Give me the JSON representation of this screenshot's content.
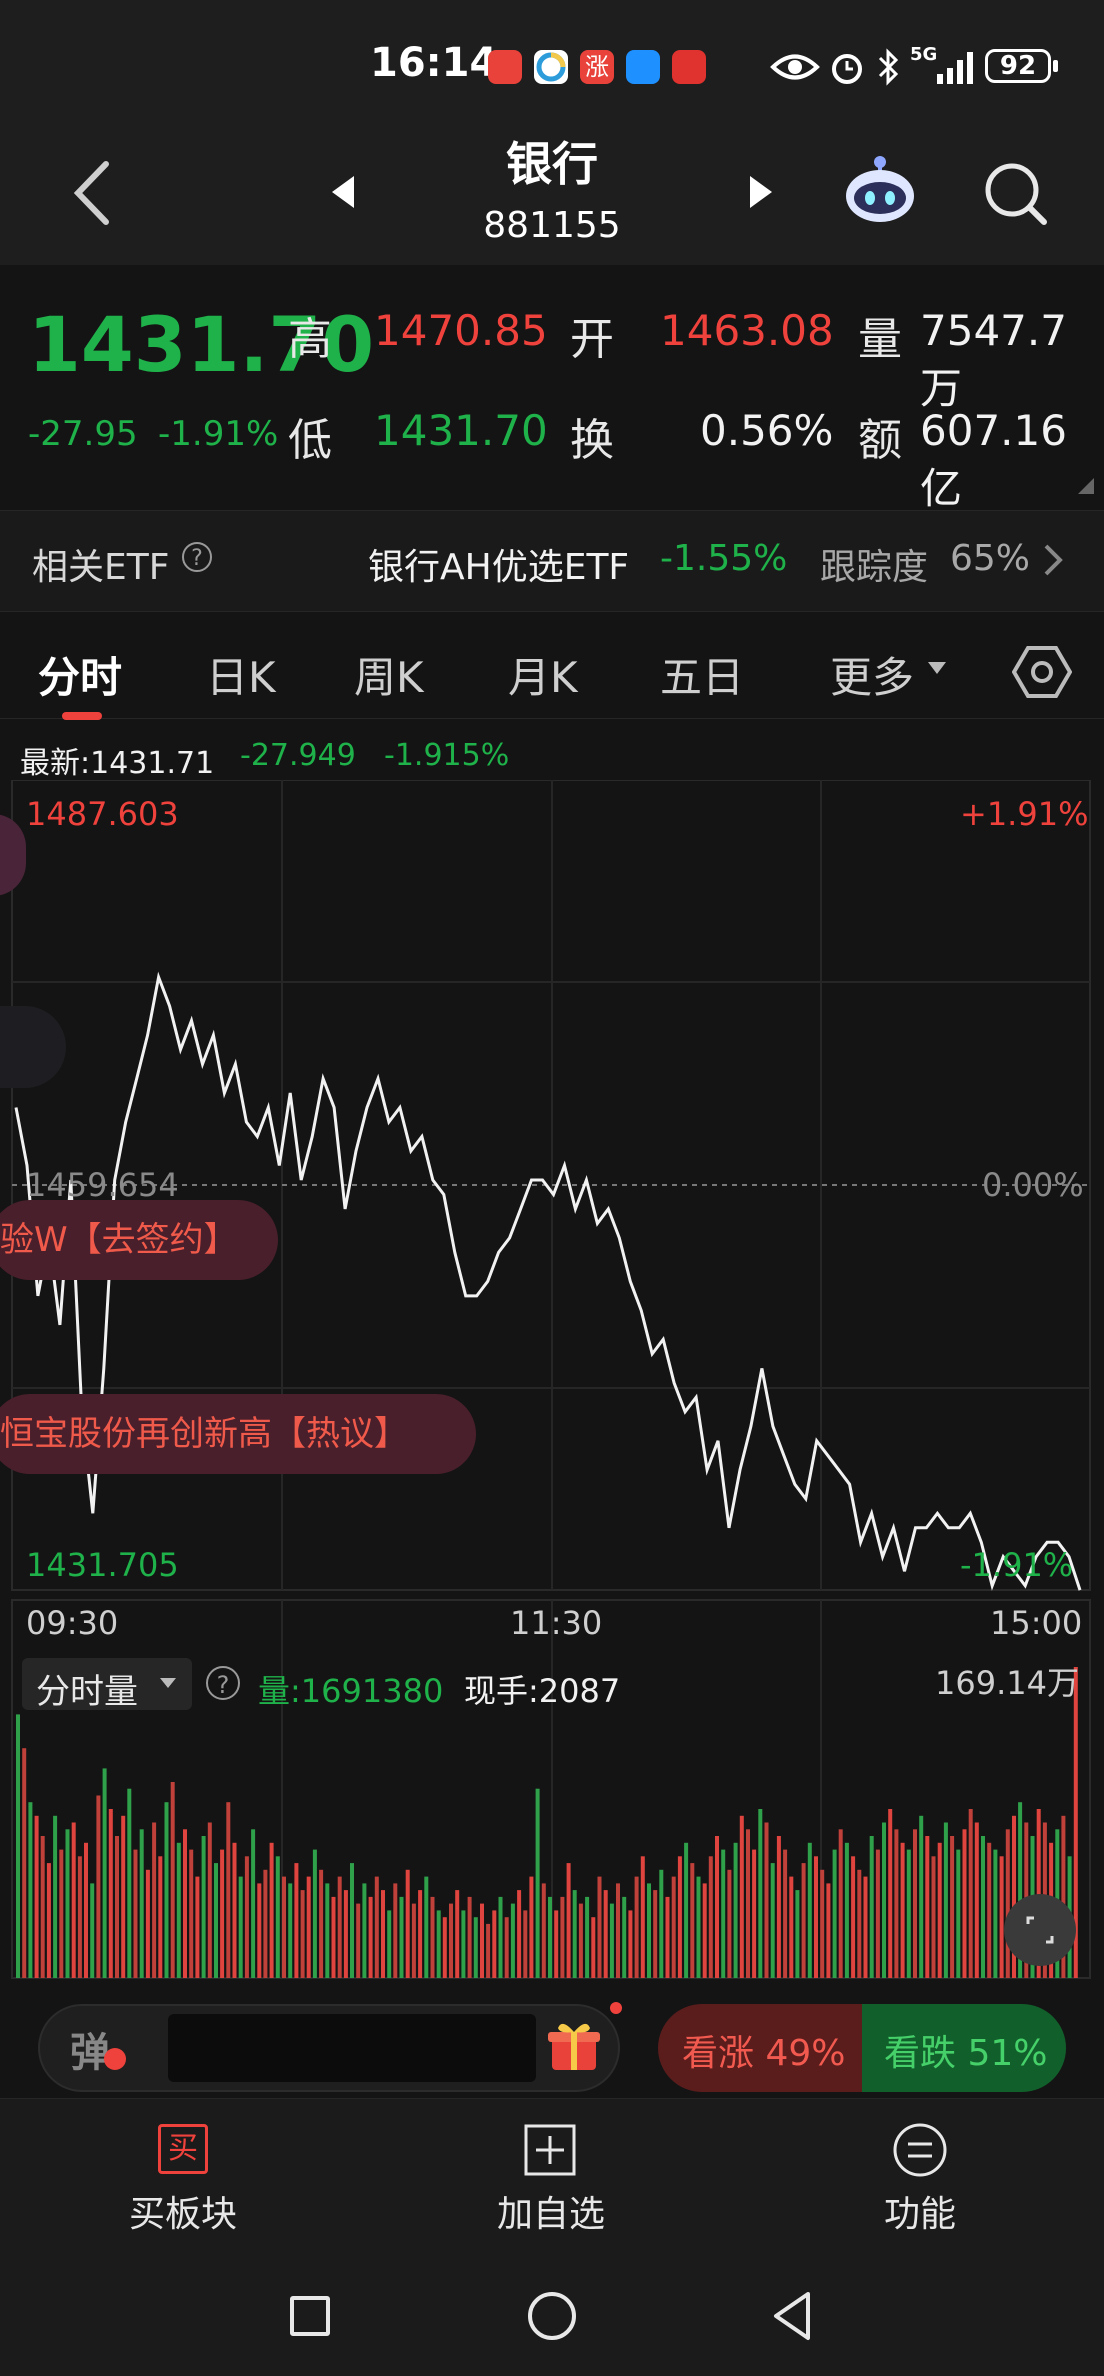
{
  "status_bar": {
    "time": "16:14",
    "battery": "92",
    "network": "5G",
    "icons": [
      "eye-icon",
      "alarm-icon",
      "bluetooth-icon",
      "signal-icon"
    ]
  },
  "header": {
    "title": "银行",
    "code": "881155"
  },
  "quote": {
    "price": "1431.70",
    "change": "-27.95",
    "change_pct": "-1.91%",
    "high_label": "高",
    "high": "1470.85",
    "open_label": "开",
    "open": "1463.08",
    "volume_label": "量",
    "volume": "7547.7万",
    "low_label": "低",
    "low": "1431.70",
    "turnover_label": "换",
    "turnover": "0.56%",
    "amount_label": "额",
    "amount": "607.16亿"
  },
  "etf": {
    "label": "相关ETF",
    "help": "?",
    "name": "银行AH优选ETF",
    "change": "-1.55%",
    "tracking_label": "跟踪度",
    "tracking": "65%"
  },
  "tabs": [
    {
      "label": "分时",
      "active": true
    },
    {
      "label": "日K"
    },
    {
      "label": "周K"
    },
    {
      "label": "月K"
    },
    {
      "label": "五日"
    },
    {
      "label": "更多"
    }
  ],
  "latest": {
    "label": "最新:1431.71",
    "change": "-27.949",
    "pct": "-1.915%"
  },
  "chart_data": {
    "type": "line",
    "y_top": "1487.603",
    "y_mid": "1459.654",
    "y_bottom": "1431.705",
    "pct_top": "+1.91%",
    "pct_mid": "0.00%",
    "pct_bottom": "-1.91%",
    "x_labels": [
      "09:30",
      "11:30",
      "15:00"
    ],
    "ylim": [
      1431.705,
      1487.603
    ],
    "prev_close": 1459.654,
    "series": [
      {
        "values": [
          1465,
          1461,
          1452,
          1456,
          1450,
          1460,
          1444,
          1437,
          1447,
          1460,
          1464,
          1467,
          1470,
          1474,
          1472,
          1469,
          1471,
          1468,
          1470,
          1466,
          1468,
          1464,
          1463,
          1465,
          1461,
          1466,
          1460,
          1463,
          1467,
          1465,
          1458,
          1462,
          1465,
          1467,
          1464,
          1465,
          1462,
          1463,
          1460,
          1459,
          1455,
          1452,
          1452,
          1453,
          1455,
          1456,
          1458,
          1460,
          1460,
          1459,
          1461,
          1458,
          1460,
          1457,
          1458,
          1456,
          1453,
          1451,
          1448,
          1449,
          1446,
          1444,
          1445,
          1440,
          1442,
          1436,
          1440,
          1443,
          1447,
          1443,
          1441,
          1439,
          1438,
          1442,
          1441,
          1440,
          1439,
          1435,
          1437,
          1434,
          1436,
          1433,
          1436,
          1436,
          1437,
          1436,
          1436,
          1437,
          1435,
          1432,
          1434,
          1433,
          1432,
          1434,
          1435,
          1435,
          1434,
          1431.7
        ]
      }
    ],
    "volume_label": "分时量",
    "volume_value": "量:1691380",
    "hand_value": "现手:2087",
    "volume_max": "169.14万",
    "volume_bars": [
      78,
      68,
      52,
      48,
      42,
      34,
      48,
      38,
      44,
      46,
      36,
      40,
      28,
      54,
      62,
      50,
      42,
      48,
      56,
      38,
      44,
      32,
      46,
      36,
      52,
      58,
      40,
      44,
      38,
      30,
      42,
      46,
      34,
      38,
      52,
      40,
      30,
      36,
      44,
      28,
      32,
      40,
      36,
      30,
      28,
      34,
      26,
      30,
      38,
      32,
      28,
      24,
      30,
      26,
      34,
      22,
      28,
      24,
      30,
      26,
      20,
      28,
      24,
      32,
      22,
      26,
      30,
      24,
      20,
      18,
      22,
      26,
      20,
      24,
      18,
      22,
      16,
      20,
      24,
      18,
      22,
      26,
      20,
      30,
      56,
      28,
      24,
      20,
      24,
      34,
      26,
      22,
      24,
      18,
      30,
      26,
      22,
      28,
      24,
      20,
      30,
      36,
      28,
      26,
      32,
      24,
      30,
      36,
      40,
      34,
      30,
      28,
      36,
      42,
      38,
      32,
      40,
      48,
      44,
      38,
      50,
      46,
      34,
      42,
      38,
      30,
      26,
      34,
      40,
      36,
      32,
      28,
      38,
      44,
      40,
      36,
      32,
      30,
      42,
      38,
      46,
      50,
      44,
      40,
      38,
      44,
      48,
      42,
      36,
      40,
      46,
      42,
      38,
      44,
      50,
      46,
      42,
      40,
      38,
      36,
      44,
      48,
      52,
      46,
      42,
      50,
      46,
      40,
      44,
      48,
      36,
      92
    ]
  },
  "pills": {
    "pill1": "验W【去签约】",
    "pill2": "恒宝股份再创新高【热议】"
  },
  "sentiment": {
    "barrage_label": "弹",
    "bull": "看涨 49%",
    "bear": "看跌 51%"
  },
  "bottom_nav": [
    {
      "label": "买板块",
      "icon": "buy-icon"
    },
    {
      "label": "加自选",
      "icon": "add-watchlist-icon"
    },
    {
      "label": "功能",
      "icon": "menu-icon"
    }
  ],
  "colors": {
    "up": "#f0423c",
    "down": "#1fb24a",
    "line": "#f2f2f2",
    "bg": "#141414"
  }
}
